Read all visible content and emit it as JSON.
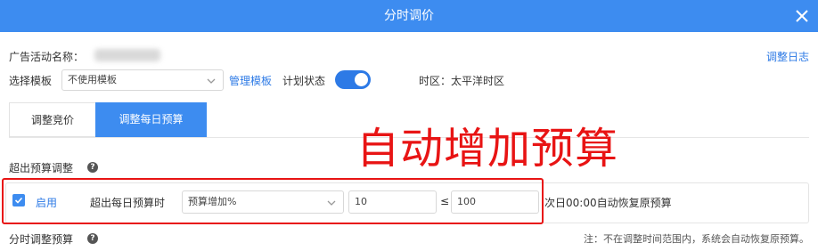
{
  "dialog": {
    "title": "分时调价",
    "close_icon": "close-icon"
  },
  "campaign": {
    "label": "广告活动名称："
  },
  "change_log": "调整日志",
  "template": {
    "label": "选择模板",
    "value": "不使用模板",
    "manage_link": "管理模板"
  },
  "plan_status": {
    "label": "计划状态",
    "on": true
  },
  "timezone": "时区：太平洋时区",
  "tabs": [
    {
      "label": "调整竞价",
      "active": false
    },
    {
      "label": "调整每日预算",
      "active": true
    }
  ],
  "overlay_text": "自动增加预算",
  "over_budget": {
    "section_title": "超出预算调整",
    "enable_label": "启用",
    "enabled": true,
    "condition_label": "超出每日预算时",
    "mode_value": "预算增加%",
    "amount_value": "10",
    "le_symbol": "≤",
    "max_value": "100",
    "restore_text": "次日00:00自动恢复原预算"
  },
  "time_budget": {
    "section_title": "分时调整预算",
    "note": "注：不在调整时间范围内，系统会自动恢复原预算。"
  },
  "colors": {
    "primary": "#3d8cf0",
    "link": "#2d7ae6",
    "annotation": "#e81414"
  }
}
